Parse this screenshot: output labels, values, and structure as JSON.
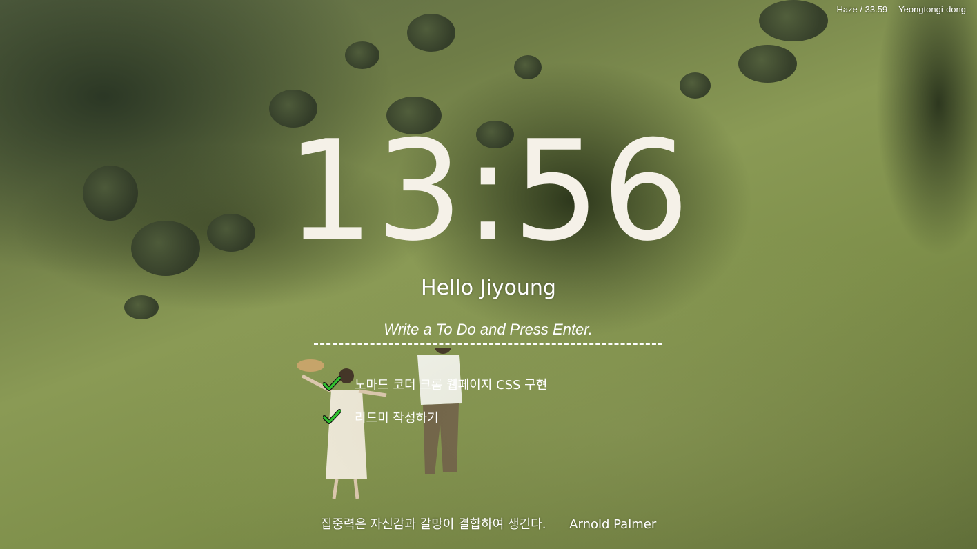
{
  "weather": {
    "condition_temp": "Haze / 33.59",
    "location": "Yeongtongi-dong"
  },
  "clock": {
    "time": "13:56"
  },
  "greeting": {
    "text": "Hello Jiyoung"
  },
  "todo_form": {
    "placeholder": "Write a To Do and Press Enter."
  },
  "todos": [
    {
      "text": "노마드 코더 크롬 웹페이지 CSS 구현",
      "icon": "check-icon"
    },
    {
      "text": "리드미 작성하기",
      "icon": "check-icon"
    }
  ],
  "quote": {
    "text": "집중력은 자신감과 갈망이 결합하여 생긴다.",
    "author": "Arnold Palmer"
  },
  "colors": {
    "check": "#2fc12f",
    "clock": "#f5f1e8",
    "text": "#ffffff"
  }
}
